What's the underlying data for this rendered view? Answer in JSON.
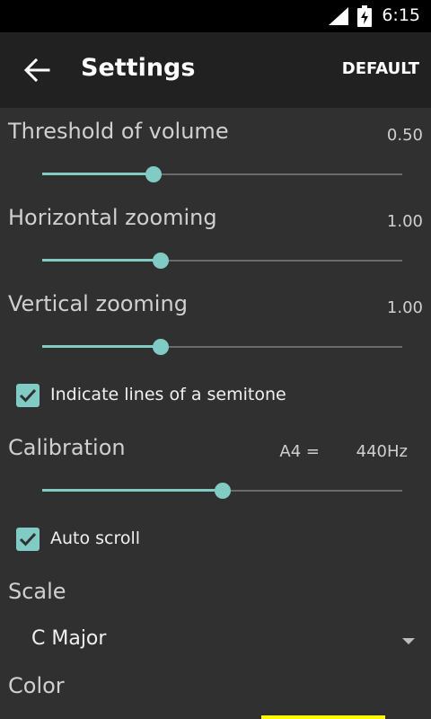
{
  "status_bar": {
    "time": "6:15",
    "signal_icon": "cell-signal-icon",
    "battery_icon": "battery-charging-icon"
  },
  "toolbar": {
    "title": "Settings",
    "default_label": "DEFAULT",
    "back_icon": "arrow-back-icon"
  },
  "settings": {
    "threshold": {
      "label": "Threshold of volume",
      "value": "0.50",
      "level": 0.31
    },
    "horizontal": {
      "label": "Horizontal zooming",
      "value": "1.00",
      "level": 0.33
    },
    "vertical": {
      "label": "Vertical zooming",
      "value": "1.00",
      "level": 0.33
    },
    "semitone": {
      "label": "Indicate lines of a semitone",
      "checked": true
    },
    "calibration": {
      "label": "Calibration",
      "prefix": "A4 =",
      "value": "440Hz",
      "level": 0.5
    },
    "autoscroll": {
      "label": "Auto scroll",
      "checked": true
    },
    "scale": {
      "label": "Scale",
      "selected": "C Major"
    },
    "color": {
      "label": "Color",
      "swatch": "#ffff00"
    }
  },
  "colors": {
    "accent": "#80cbc4",
    "background": "#303030",
    "toolbar": "#212121",
    "statusbar": "#000000"
  }
}
